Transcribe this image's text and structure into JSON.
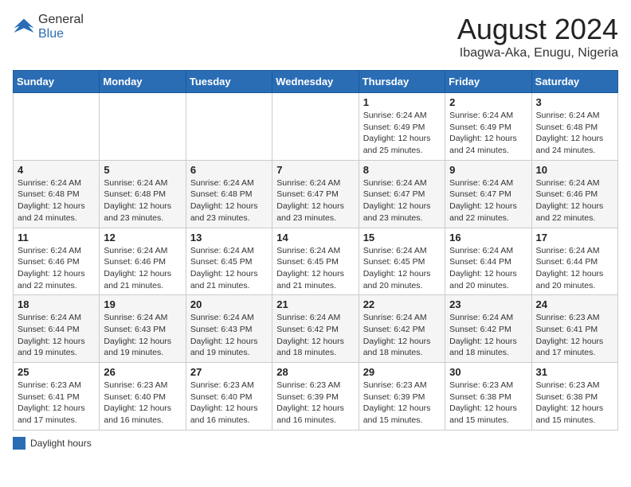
{
  "header": {
    "logo_general": "General",
    "logo_blue": "Blue",
    "month_title": "August 2024",
    "location": "Ibagwa-Aka, Enugu, Nigeria"
  },
  "days_of_week": [
    "Sunday",
    "Monday",
    "Tuesday",
    "Wednesday",
    "Thursday",
    "Friday",
    "Saturday"
  ],
  "legend_label": "Daylight hours",
  "weeks": [
    [
      {
        "day": "",
        "info": ""
      },
      {
        "day": "",
        "info": ""
      },
      {
        "day": "",
        "info": ""
      },
      {
        "day": "",
        "info": ""
      },
      {
        "day": "1",
        "info": "Sunrise: 6:24 AM\nSunset: 6:49 PM\nDaylight: 12 hours\nand 25 minutes."
      },
      {
        "day": "2",
        "info": "Sunrise: 6:24 AM\nSunset: 6:49 PM\nDaylight: 12 hours\nand 24 minutes."
      },
      {
        "day": "3",
        "info": "Sunrise: 6:24 AM\nSunset: 6:48 PM\nDaylight: 12 hours\nand 24 minutes."
      }
    ],
    [
      {
        "day": "4",
        "info": "Sunrise: 6:24 AM\nSunset: 6:48 PM\nDaylight: 12 hours\nand 24 minutes."
      },
      {
        "day": "5",
        "info": "Sunrise: 6:24 AM\nSunset: 6:48 PM\nDaylight: 12 hours\nand 23 minutes."
      },
      {
        "day": "6",
        "info": "Sunrise: 6:24 AM\nSunset: 6:48 PM\nDaylight: 12 hours\nand 23 minutes."
      },
      {
        "day": "7",
        "info": "Sunrise: 6:24 AM\nSunset: 6:47 PM\nDaylight: 12 hours\nand 23 minutes."
      },
      {
        "day": "8",
        "info": "Sunrise: 6:24 AM\nSunset: 6:47 PM\nDaylight: 12 hours\nand 23 minutes."
      },
      {
        "day": "9",
        "info": "Sunrise: 6:24 AM\nSunset: 6:47 PM\nDaylight: 12 hours\nand 22 minutes."
      },
      {
        "day": "10",
        "info": "Sunrise: 6:24 AM\nSunset: 6:46 PM\nDaylight: 12 hours\nand 22 minutes."
      }
    ],
    [
      {
        "day": "11",
        "info": "Sunrise: 6:24 AM\nSunset: 6:46 PM\nDaylight: 12 hours\nand 22 minutes."
      },
      {
        "day": "12",
        "info": "Sunrise: 6:24 AM\nSunset: 6:46 PM\nDaylight: 12 hours\nand 21 minutes."
      },
      {
        "day": "13",
        "info": "Sunrise: 6:24 AM\nSunset: 6:45 PM\nDaylight: 12 hours\nand 21 minutes."
      },
      {
        "day": "14",
        "info": "Sunrise: 6:24 AM\nSunset: 6:45 PM\nDaylight: 12 hours\nand 21 minutes."
      },
      {
        "day": "15",
        "info": "Sunrise: 6:24 AM\nSunset: 6:45 PM\nDaylight: 12 hours\nand 20 minutes."
      },
      {
        "day": "16",
        "info": "Sunrise: 6:24 AM\nSunset: 6:44 PM\nDaylight: 12 hours\nand 20 minutes."
      },
      {
        "day": "17",
        "info": "Sunrise: 6:24 AM\nSunset: 6:44 PM\nDaylight: 12 hours\nand 20 minutes."
      }
    ],
    [
      {
        "day": "18",
        "info": "Sunrise: 6:24 AM\nSunset: 6:44 PM\nDaylight: 12 hours\nand 19 minutes."
      },
      {
        "day": "19",
        "info": "Sunrise: 6:24 AM\nSunset: 6:43 PM\nDaylight: 12 hours\nand 19 minutes."
      },
      {
        "day": "20",
        "info": "Sunrise: 6:24 AM\nSunset: 6:43 PM\nDaylight: 12 hours\nand 19 minutes."
      },
      {
        "day": "21",
        "info": "Sunrise: 6:24 AM\nSunset: 6:42 PM\nDaylight: 12 hours\nand 18 minutes."
      },
      {
        "day": "22",
        "info": "Sunrise: 6:24 AM\nSunset: 6:42 PM\nDaylight: 12 hours\nand 18 minutes."
      },
      {
        "day": "23",
        "info": "Sunrise: 6:24 AM\nSunset: 6:42 PM\nDaylight: 12 hours\nand 18 minutes."
      },
      {
        "day": "24",
        "info": "Sunrise: 6:23 AM\nSunset: 6:41 PM\nDaylight: 12 hours\nand 17 minutes."
      }
    ],
    [
      {
        "day": "25",
        "info": "Sunrise: 6:23 AM\nSunset: 6:41 PM\nDaylight: 12 hours\nand 17 minutes."
      },
      {
        "day": "26",
        "info": "Sunrise: 6:23 AM\nSunset: 6:40 PM\nDaylight: 12 hours\nand 16 minutes."
      },
      {
        "day": "27",
        "info": "Sunrise: 6:23 AM\nSunset: 6:40 PM\nDaylight: 12 hours\nand 16 minutes."
      },
      {
        "day": "28",
        "info": "Sunrise: 6:23 AM\nSunset: 6:39 PM\nDaylight: 12 hours\nand 16 minutes."
      },
      {
        "day": "29",
        "info": "Sunrise: 6:23 AM\nSunset: 6:39 PM\nDaylight: 12 hours\nand 15 minutes."
      },
      {
        "day": "30",
        "info": "Sunrise: 6:23 AM\nSunset: 6:38 PM\nDaylight: 12 hours\nand 15 minutes."
      },
      {
        "day": "31",
        "info": "Sunrise: 6:23 AM\nSunset: 6:38 PM\nDaylight: 12 hours\nand 15 minutes."
      }
    ]
  ]
}
